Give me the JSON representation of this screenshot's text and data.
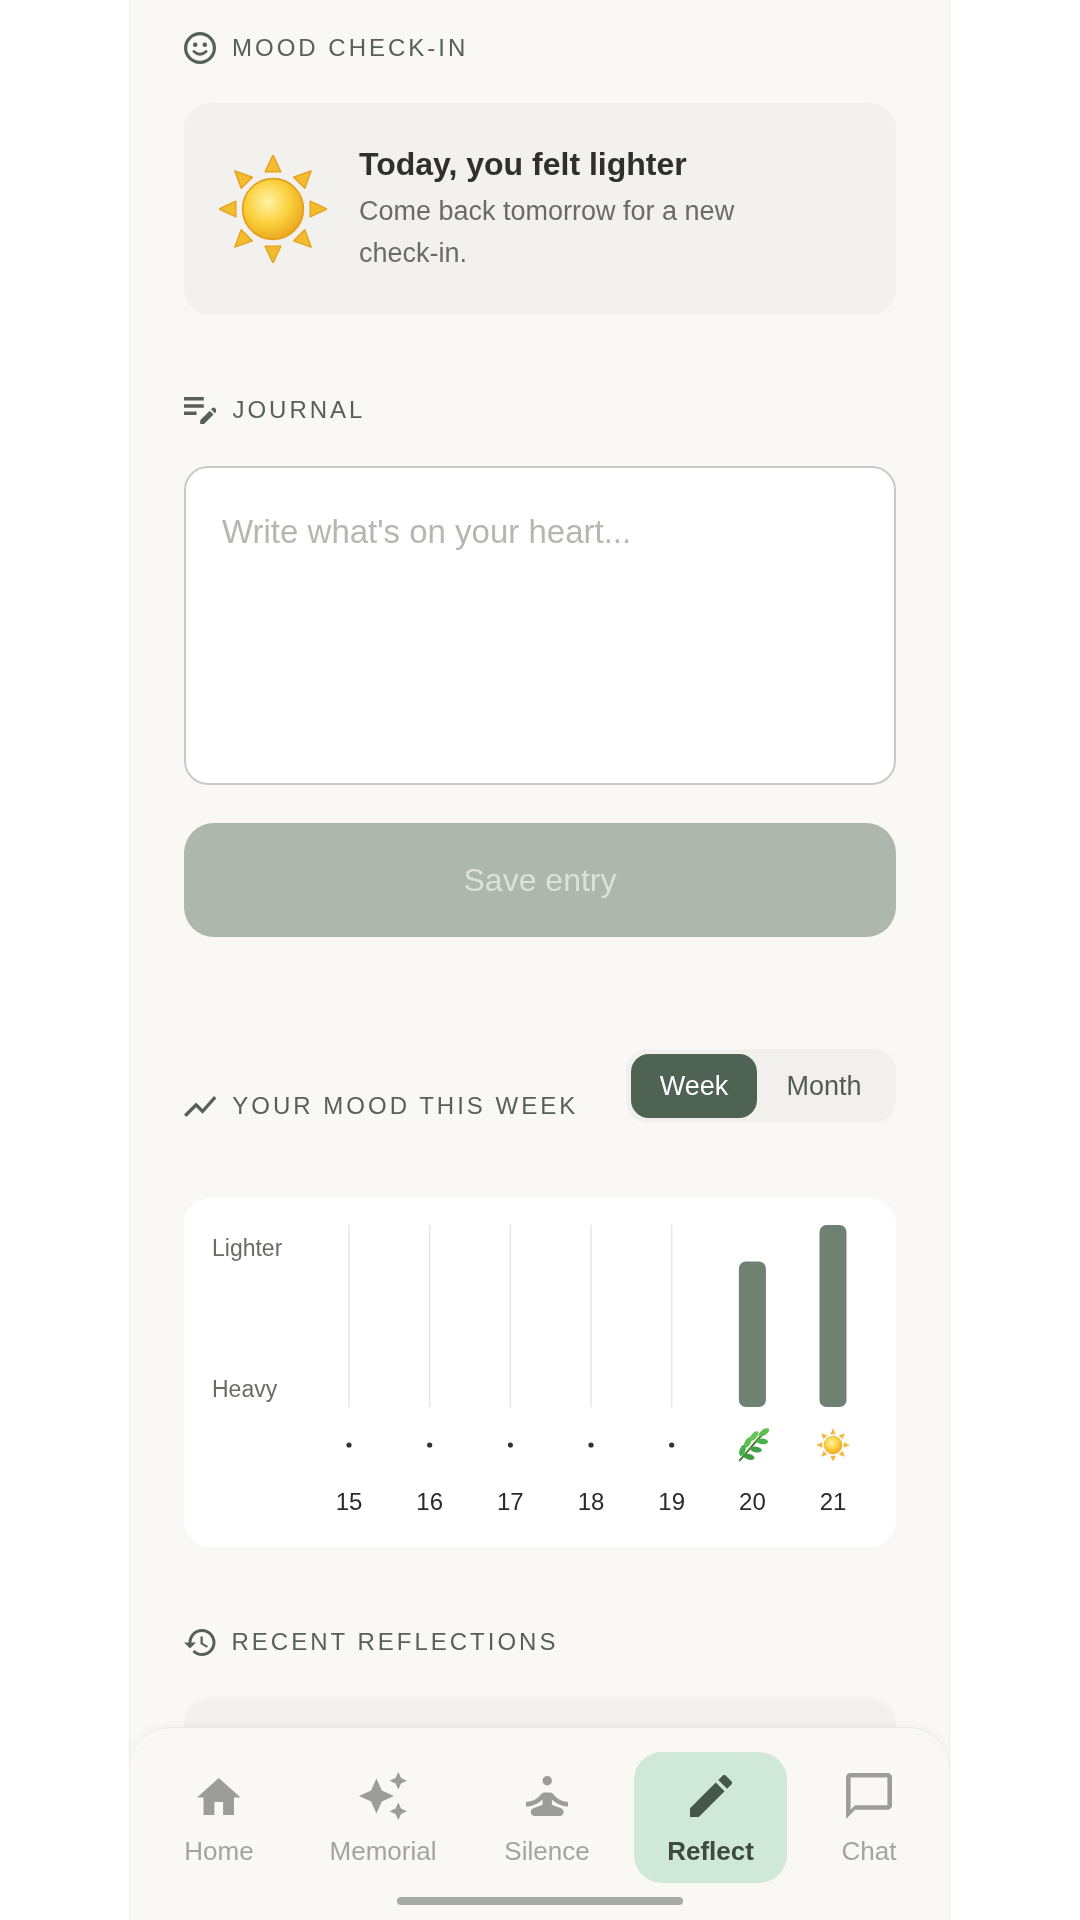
{
  "mood_checkin": {
    "title": "MOOD CHECK-IN",
    "headline": "Today, you felt lighter",
    "message": "Come back tomorrow for a new check-in."
  },
  "journal": {
    "title": "JOURNAL",
    "placeholder": "Write what's on your heart...",
    "save_button": {
      "label": "Save entry",
      "disabled": true
    }
  },
  "mood_chart": {
    "title": "YOUR MOOD THIS WEEK",
    "tabs": [
      {
        "label": "Week",
        "selected": true
      },
      {
        "label": "Month",
        "selected": false
      }
    ],
    "scale_labels": {
      "top": "Lighter",
      "bottom": "Heavy"
    },
    "days": [
      {
        "label": "15",
        "kind": "empty"
      },
      {
        "label": "16",
        "kind": "empty"
      },
      {
        "label": "17",
        "kind": "empty"
      },
      {
        "label": "18",
        "kind": "empty"
      },
      {
        "label": "19",
        "kind": "empty"
      },
      {
        "label": "20",
        "kind": "leaf"
      },
      {
        "label": "21",
        "kind": "sun"
      }
    ]
  },
  "recent_reflections": {
    "title": "RECENT REFLECTIONS"
  },
  "bottom_nav": {
    "items": [
      {
        "label": "Home",
        "selected": false
      },
      {
        "label": "Memorial",
        "selected": false
      },
      {
        "label": "Silence",
        "selected": false
      },
      {
        "label": "Reflect",
        "selected": true
      },
      {
        "label": "Chat",
        "selected": false
      }
    ]
  }
}
